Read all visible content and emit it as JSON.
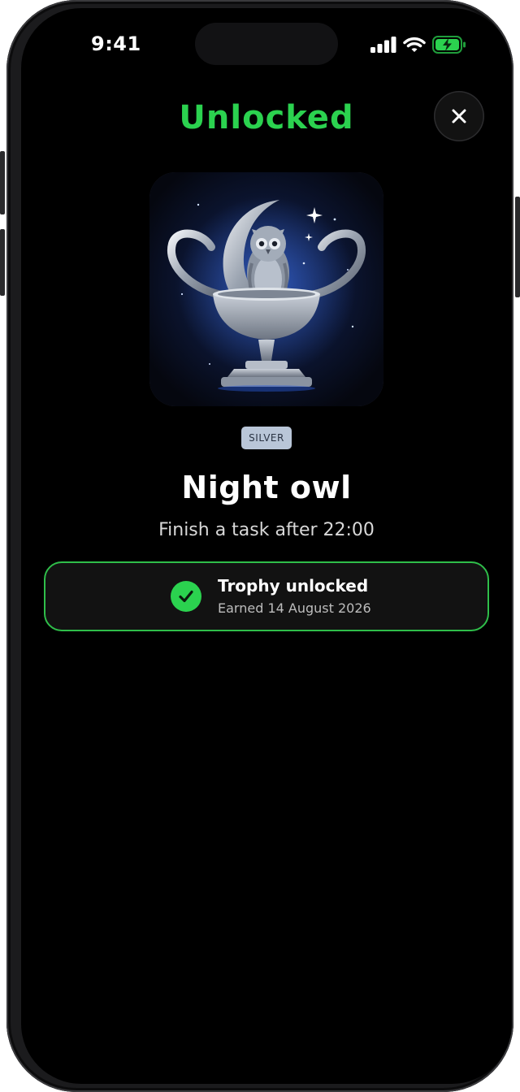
{
  "status_bar": {
    "time": "9:41",
    "signal_icon": "cellular-signal-icon",
    "wifi_icon": "wifi-icon",
    "battery_icon": "battery-charging-icon"
  },
  "header": {
    "title": "Unlocked",
    "close_icon": "close-icon"
  },
  "trophy": {
    "image": "silver-owl-moon-trophy",
    "tier": "SILVER",
    "name": "Night owl",
    "description": "Finish a task after 22:00"
  },
  "status_card": {
    "icon": "checkmark-circle-icon",
    "title": "Trophy unlocked",
    "subtitle": "Earned 14 August 2026"
  },
  "colors": {
    "accent_green": "#2bd24f",
    "background": "#000000",
    "tier_badge": "#b9c6d8"
  }
}
